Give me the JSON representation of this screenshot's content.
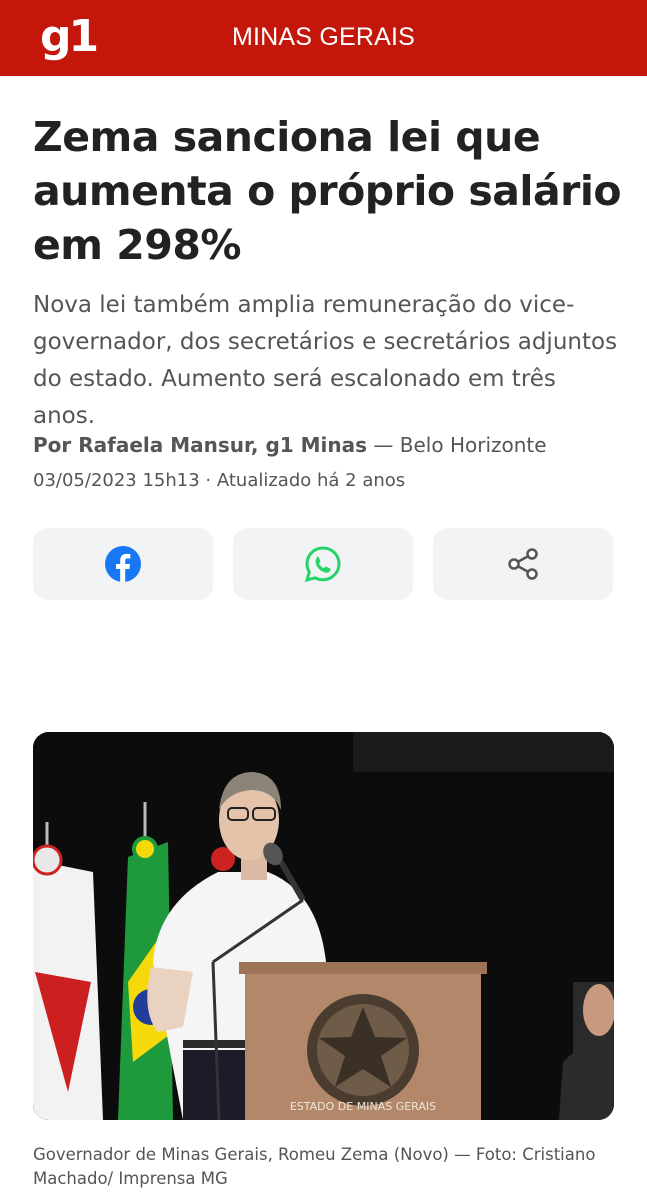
{
  "header": {
    "logo": "g1",
    "section": "MINAS GERAIS",
    "bg_color": "#c4170c"
  },
  "article": {
    "headline": "Zema sanciona lei que aumenta o próprio salário em 298%",
    "subtitle": "Nova lei também amplia remuneração do vice-governador, dos secretários e secretários adjuntos do estado. Aumento será escalonado em três anos.",
    "author": "Por Rafaela Mansur, g1 Minas",
    "location": " — Belo Horizonte",
    "date": "03/05/2023 15h13 · Atualizado há 2 anos"
  },
  "share": [
    {
      "icon": "facebook-icon",
      "color": "#1877f2"
    },
    {
      "icon": "whatsapp-icon",
      "color": "#25d366"
    },
    {
      "icon": "share-icon",
      "color": "#555555"
    }
  ],
  "photo": {
    "seal_text": "ESTADO DE MINAS GERAIS",
    "caption": "Governador de Minas Gerais, Romeu Zema (Novo) — Foto: Cristiano Machado/ Imprensa MG"
  }
}
